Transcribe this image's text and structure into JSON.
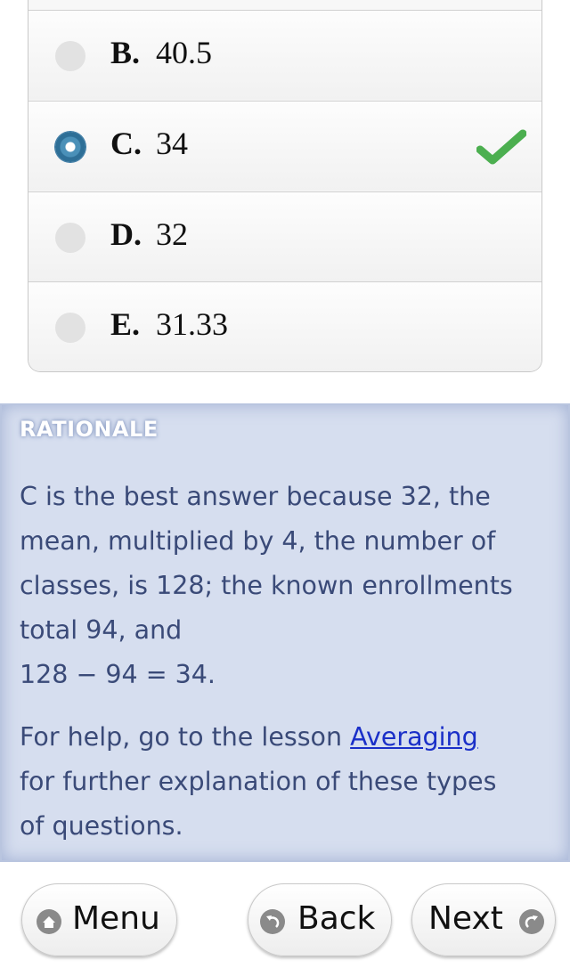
{
  "options": [
    {
      "letter": "B.",
      "text": "40.5",
      "selected": false,
      "correct": false
    },
    {
      "letter": "C.",
      "text": "34",
      "selected": true,
      "correct": true
    },
    {
      "letter": "D.",
      "text": "32",
      "selected": false,
      "correct": false
    },
    {
      "letter": "E.",
      "text": "31.33",
      "selected": false,
      "correct": false
    }
  ],
  "rationale": {
    "title": "RATIONALE",
    "line1": "C is the best answer because 32, the",
    "line2": "mean, multiplied by 4, the number of",
    "line3": "classes, is 128; the known enrollments",
    "line4": "total 94, and",
    "line5": "128 − 94 = 34.",
    "help_prefix": "For help, go to the lesson ",
    "help_link": "Averaging",
    "help_line2": "for further explanation of these types",
    "help_line3": "of questions."
  },
  "nav": {
    "menu": "Menu",
    "back": "Back",
    "next": "Next"
  },
  "colors": {
    "check": "#4caf50",
    "selected_radio": "#3b7aa5",
    "rationale_bg": "#d6deef",
    "rationale_text": "#3a4a78",
    "link": "#1a2fc8"
  },
  "icons": {
    "correct": "checkmark-icon",
    "menu": "home-icon",
    "back": "back-arrow-icon",
    "next": "forward-arrow-icon"
  }
}
